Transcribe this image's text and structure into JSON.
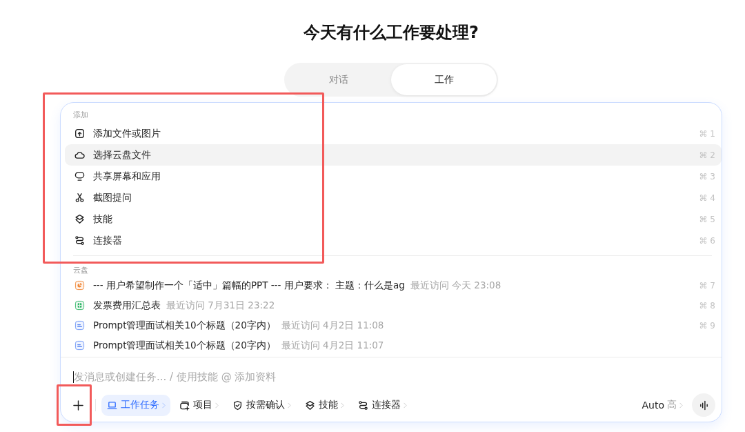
{
  "title": "今天有什么工作要处理?",
  "tabs": [
    {
      "label": "对话",
      "selected": false
    },
    {
      "label": "工作",
      "selected": true
    }
  ],
  "menu": {
    "highlighted": true,
    "section_label": "添加",
    "items": [
      {
        "kind": "upload",
        "label": "添加文件或图片",
        "shortcut": "⌘ 1",
        "selected": false
      },
      {
        "kind": "cloud",
        "label": "选择云盘文件",
        "shortcut": "⌘ 2",
        "selected": true
      },
      {
        "kind": "screen",
        "label": "共享屏幕和应用",
        "shortcut": "⌘ 3",
        "selected": false
      },
      {
        "kind": "screenshot",
        "label": "截图提问",
        "shortcut": "⌘ 4",
        "selected": false
      },
      {
        "kind": "skill",
        "label": "技能",
        "shortcut": "⌘ 5",
        "selected": false
      },
      {
        "kind": "connector",
        "label": "连接器",
        "shortcut": "⌘ 6",
        "selected": false
      }
    ]
  },
  "cloud": {
    "section_label": "云盘",
    "items": [
      {
        "kind": "ppt",
        "title": "--- 用户希望制作一个「适中」篇幅的PPT --- 用户要求： 主题：什么是ag",
        "visited": "最近访问 今天 23:08",
        "shortcut": "⌘ 7",
        "selected": false
      },
      {
        "kind": "sheet",
        "title": "发票费用汇总表",
        "visited": "最近访问 7月31日 23:22",
        "shortcut": "⌘ 8",
        "selected": false
      },
      {
        "kind": "doc",
        "title": "Prompt管理面试相关10个标题（20字内）",
        "visited": "最近访问 4月2日 11:08",
        "shortcut": "⌘ 9",
        "selected": false
      },
      {
        "kind": "doc",
        "title": "Prompt管理面试相关10个标题（20字内）",
        "visited": "最近访问 4月2日 11:07",
        "selected": false
      }
    ]
  },
  "composer": {
    "placeholder": "发消息或创建任务... / 使用技能 @ 添加资料",
    "focused": true,
    "add_highlighted": true,
    "tools": [
      {
        "kind": "task",
        "label": "工作任务",
        "selected": true
      },
      {
        "kind": "project",
        "label": "项目",
        "selected": false
      },
      {
        "kind": "confirm",
        "label": "按需确认",
        "selected": false
      },
      {
        "kind": "skill",
        "label": "技能",
        "selected": false
      },
      {
        "kind": "connector",
        "label": "连接器",
        "selected": false
      }
    ],
    "mode": "Auto",
    "effort": "高"
  }
}
